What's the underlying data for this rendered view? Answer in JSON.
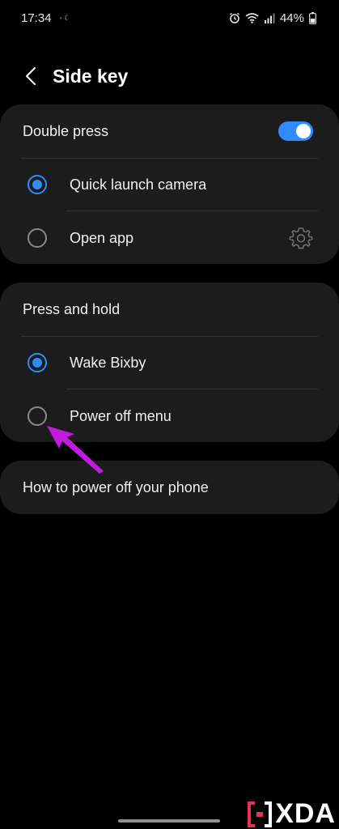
{
  "status_bar": {
    "time": "17:34",
    "battery_text": "44%",
    "icons": [
      "alarm-icon",
      "wifi-icon",
      "signal-icon",
      "battery-icon"
    ]
  },
  "header": {
    "title": "Side key"
  },
  "double_press": {
    "title": "Double press",
    "toggle_on": true,
    "options": [
      {
        "label": "Quick launch camera",
        "selected": true
      },
      {
        "label": "Open app",
        "selected": false
      }
    ]
  },
  "press_and_hold": {
    "title": "Press and hold",
    "options": [
      {
        "label": "Wake Bixby",
        "selected": true
      },
      {
        "label": "Power off menu",
        "selected": false
      }
    ]
  },
  "help_link": {
    "label": "How to power off your phone"
  },
  "watermark": {
    "text": "XDA"
  },
  "colors": {
    "accent": "#2f8cff",
    "annotation": "#c21be0",
    "card": "#1c1c1c",
    "background": "#000000"
  }
}
